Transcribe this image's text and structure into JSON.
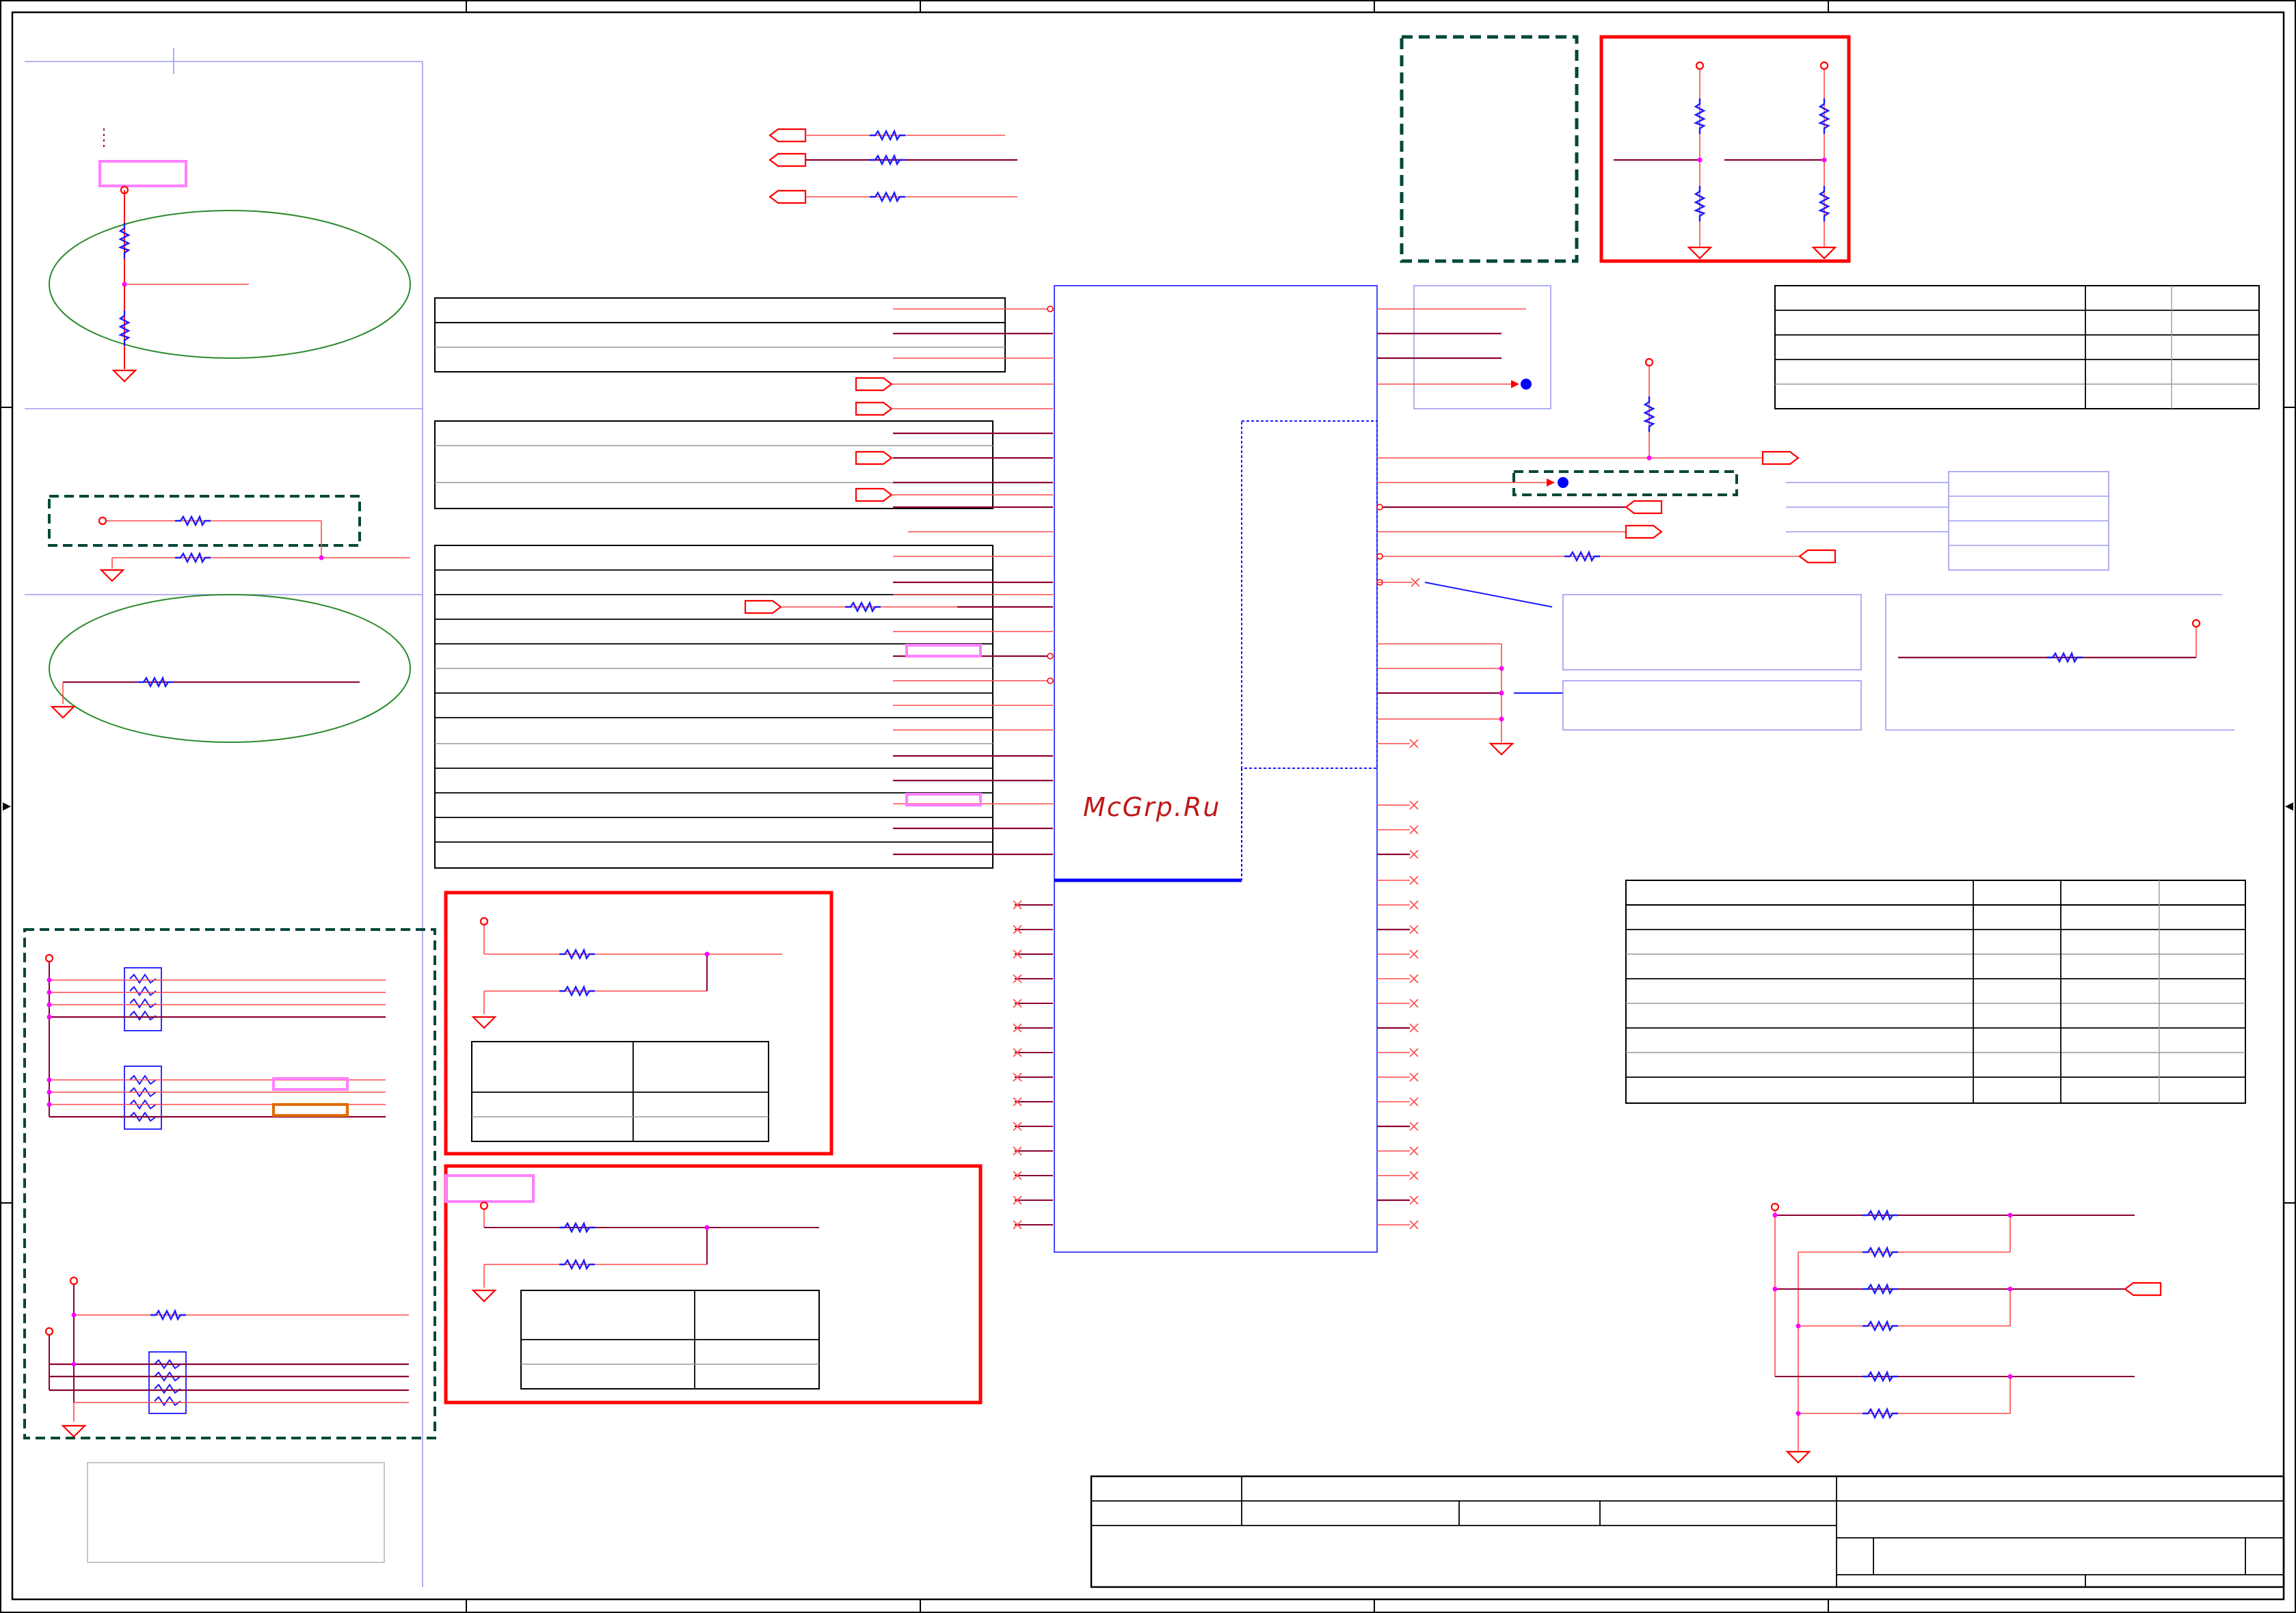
{
  "watermark": "McGrp.Ru",
  "colors": {
    "frame": "#000000",
    "wire": "#ff0000",
    "wire_dark": "#8b0033",
    "bus": "#0000ff",
    "net_box": "#9b9bf0",
    "dashed_box": "#00473a",
    "highlight_box": "#ff0000",
    "ellipse": "#2a8a2a",
    "magenta": "#ff00ff",
    "pink_box": "#ff80ff",
    "orange_box": "#e06a00"
  },
  "icons": {
    "resistor": "zigzag-resistor-icon",
    "ground": "ground-triangle-icon",
    "power": "power-pin-circle-icon",
    "port": "off-page-port-icon",
    "no_connect": "no-connect-cross-icon"
  }
}
